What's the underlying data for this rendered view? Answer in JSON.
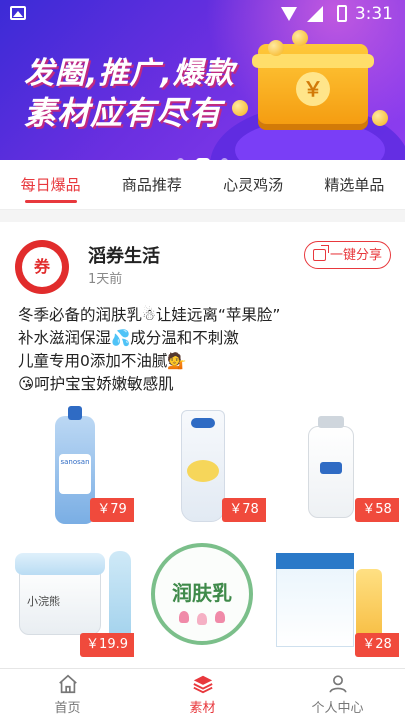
{
  "status_bar": {
    "time": "3:31"
  },
  "banner": {
    "line1": "发圈,推广,爆款",
    "line2": "素材应有尽有",
    "wallet_symbol": "￥"
  },
  "tabs": [
    {
      "label": "每日爆品",
      "active": true
    },
    {
      "label": "商品推荐",
      "active": false
    },
    {
      "label": "心灵鸡汤",
      "active": false
    },
    {
      "label": "精选单品",
      "active": false
    }
  ],
  "post": {
    "avatar_text": "券",
    "author": "滔券生活",
    "time": "1天前",
    "share_label": "一键分享",
    "lines": [
      "冬季必备的润肤乳☃让娃远离“苹果脸”",
      "补水滋润保湿💦成分温和不刺激",
      "儿童专用0添加不油腻💁",
      "😘呵护宝宝娇嫩敏感肌"
    ],
    "products": [
      {
        "name": "sanosan",
        "price": "￥79"
      },
      {
        "name": "",
        "price": "￥78"
      },
      {
        "name": "",
        "price": "￥58"
      },
      {
        "name": "小浣熊",
        "price": "￥19.9"
      },
      {
        "name": "润肤乳",
        "price": ""
      },
      {
        "name": "",
        "price": "￥28"
      }
    ]
  },
  "bottom_nav": [
    {
      "label": "首页",
      "icon": "home-icon",
      "active": false
    },
    {
      "label": "素材",
      "icon": "layers-icon",
      "active": true
    },
    {
      "label": "个人中心",
      "icon": "person-icon",
      "active": false
    }
  ],
  "colors": {
    "accent": "#e8383d",
    "banner_start": "#3b2bd6",
    "banner_end": "#8f3ef0"
  }
}
